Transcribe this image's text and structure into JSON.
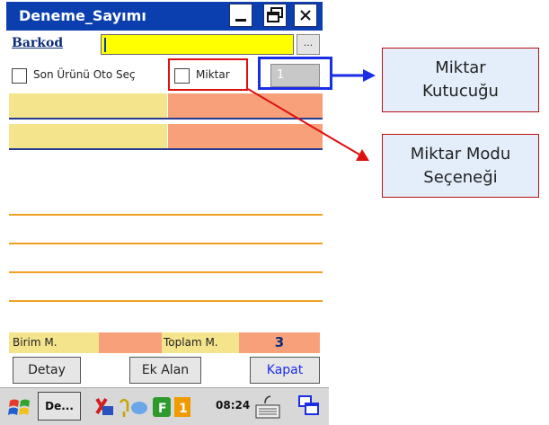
{
  "window": {
    "title": "Deneme_Sayımı",
    "minimize": "_",
    "close": "×"
  },
  "barkod": {
    "label": "Barkod",
    "value": "",
    "browse_label": "..."
  },
  "options": {
    "son_urunu": "Son Ürünü  Oto Seç",
    "miktar": "Miktar",
    "quantity_value": "1"
  },
  "totals": {
    "birim_label": "Birim M.",
    "toplam_label": "Toplam M.",
    "toplam_value": "3"
  },
  "buttons": {
    "detay": "Detay",
    "ek_alan": "Ek Alan",
    "kapat": "Kapat"
  },
  "taskbar": {
    "task_label": "De...",
    "clock": "08:24"
  },
  "callouts": {
    "kutucugu": "Miktar\nKutucuğu",
    "mod": "Miktar Modu\nSeçeneği"
  },
  "colors": {
    "title_bar": "#0b3fb0",
    "barcode_field": "#ffff00",
    "row_yellow": "#f4e48c",
    "row_salmon": "#f7a07a",
    "highlight_red": "#e01010",
    "highlight_blue": "#1a2ee6"
  }
}
